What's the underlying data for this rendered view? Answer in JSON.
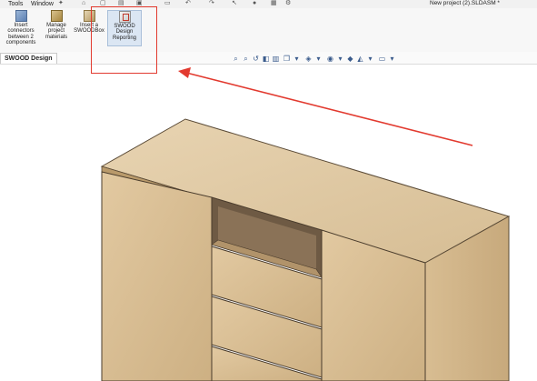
{
  "menubar": {
    "items": [
      "Tools",
      "Window"
    ],
    "document_title": "New project (2).SLDASM *"
  },
  "ribbon": {
    "buttons": [
      {
        "label": "Insert connectors between 2 components",
        "lines": [
          "Insert",
          "connectors",
          "between 2",
          "components"
        ],
        "icon": "connector-icon"
      },
      {
        "label": "Manage project materials",
        "lines": [
          "Manage",
          "project",
          "materials"
        ],
        "icon": "materials-icon"
      },
      {
        "label": "Insert a SWOODBox",
        "lines": [
          "Insert a",
          "SWOODBox"
        ],
        "icon": "swoodbox-icon"
      },
      {
        "label": "SWOOD Design Reporting",
        "lines": [
          "SWOOD",
          "Design",
          "Reporting"
        ],
        "icon": "reporting-icon"
      }
    ]
  },
  "tabs": [
    {
      "label": "SWOOD Design",
      "active": true
    }
  ],
  "colors": {
    "highlight": "#e23a2f",
    "wood_light": "#dcc29a",
    "wood_mid": "#cfb184",
    "wood_dark": "#a88755"
  }
}
